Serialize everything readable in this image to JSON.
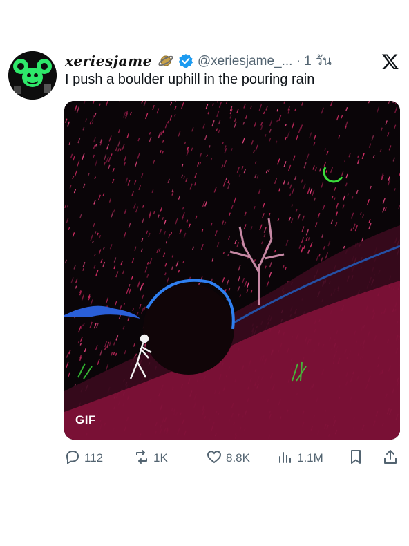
{
  "author": {
    "display_name": "xeriesjame",
    "handle_time": "@xeriesjame_... · 1 วัน"
  },
  "tweet": {
    "text": "I push a boulder uphill in the pouring rain",
    "media_badge": "GIF"
  },
  "actions": {
    "replies": "112",
    "reposts": "1K",
    "likes": "8.8K",
    "views": "1.1M"
  },
  "colors": {
    "text": "#0f1419",
    "secondary": "#536471",
    "verified": "#1d9bf0",
    "rain": "#e0306a",
    "moon": "#3bdc3b"
  },
  "icons": [
    "planet-emoji-icon",
    "verified-badge-icon",
    "x-logo-icon",
    "reply-icon",
    "repost-icon",
    "like-icon",
    "views-icon",
    "bookmark-icon",
    "share-icon"
  ]
}
